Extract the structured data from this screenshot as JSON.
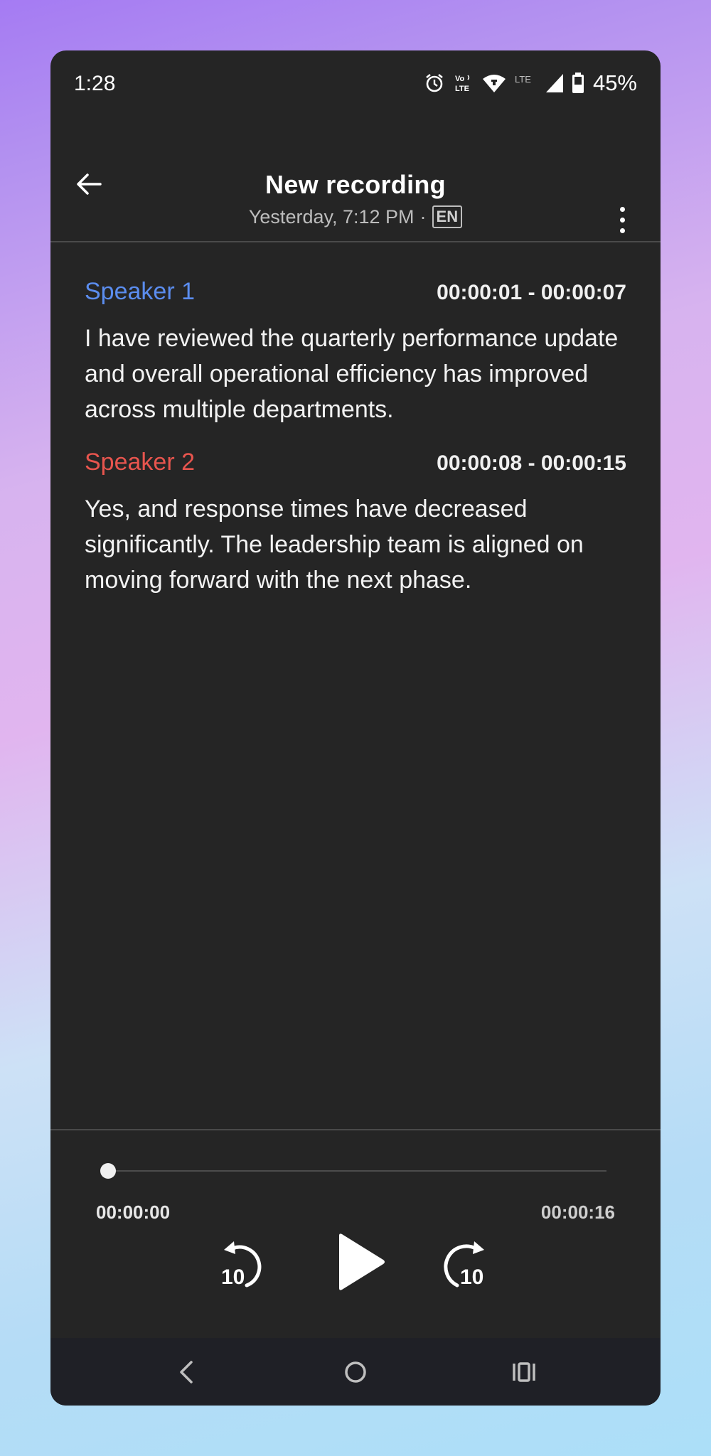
{
  "status_bar": {
    "time": "1:28",
    "battery": "45%",
    "icons": [
      "alarm-icon",
      "volte-icon",
      "wifi-icon",
      "lte-icon",
      "signal-icon",
      "battery-icon"
    ],
    "volte_label": "Vo))\nLTE",
    "lte_label": "LTE"
  },
  "header": {
    "title": "New recording",
    "date": "Yesterday, 7:12 PM",
    "separator": "·",
    "language": "EN",
    "back_icon": "arrow-left-icon",
    "more_icon": "more-vert-icon"
  },
  "transcript": [
    {
      "speaker": "Speaker 1",
      "color": "#5b8def",
      "time": "00:00:01 - 00:00:07",
      "text": "I have reviewed the quarterly performance update and overall operational efficiency has improved across multiple departments."
    },
    {
      "speaker": "Speaker 2",
      "color": "#e8554e",
      "time": "00:00:08 - 00:00:15",
      "text": "Yes, and response times have decreased significantly. The leadership team is aligned on moving forward with the next phase."
    }
  ],
  "player": {
    "current": "00:00:00",
    "total": "00:00:16",
    "progress": 0,
    "rewind_label": "10",
    "forward_label": "10"
  },
  "nav": {
    "icons": [
      "nav-back-icon",
      "nav-home-icon",
      "nav-recents-icon"
    ]
  }
}
